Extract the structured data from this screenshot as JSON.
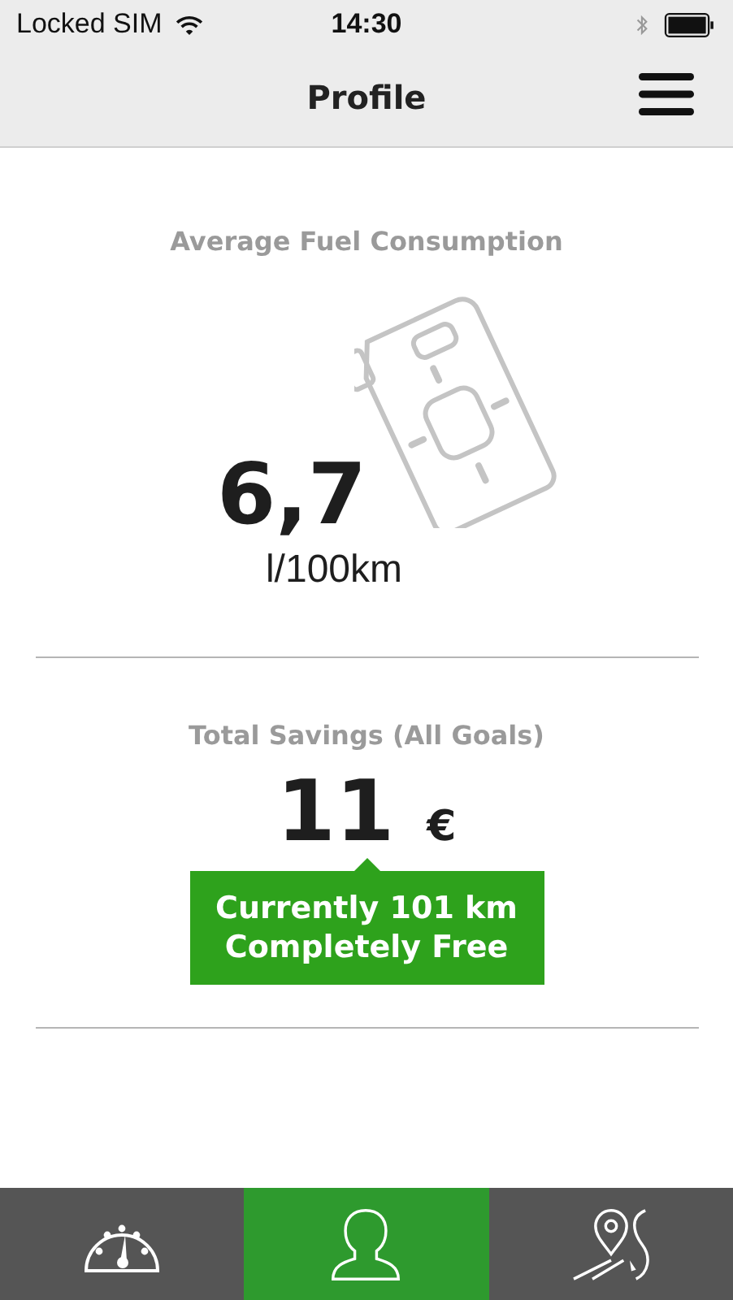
{
  "status_bar": {
    "carrier": "Locked SIM",
    "time": "14:30"
  },
  "nav": {
    "title": "Profile"
  },
  "fuel": {
    "title": "Average Fuel Consumption",
    "value": "6,7",
    "unit": "l/100km"
  },
  "savings": {
    "title": "Total Savings (All Goals)",
    "value": "11",
    "currency": "€",
    "callout": [
      "Currently 101 km",
      "Completely Free"
    ]
  },
  "tabs": [
    {
      "kind": "gauge",
      "selected": false
    },
    {
      "kind": "profile",
      "selected": true
    },
    {
      "kind": "route",
      "selected": false
    }
  ]
}
